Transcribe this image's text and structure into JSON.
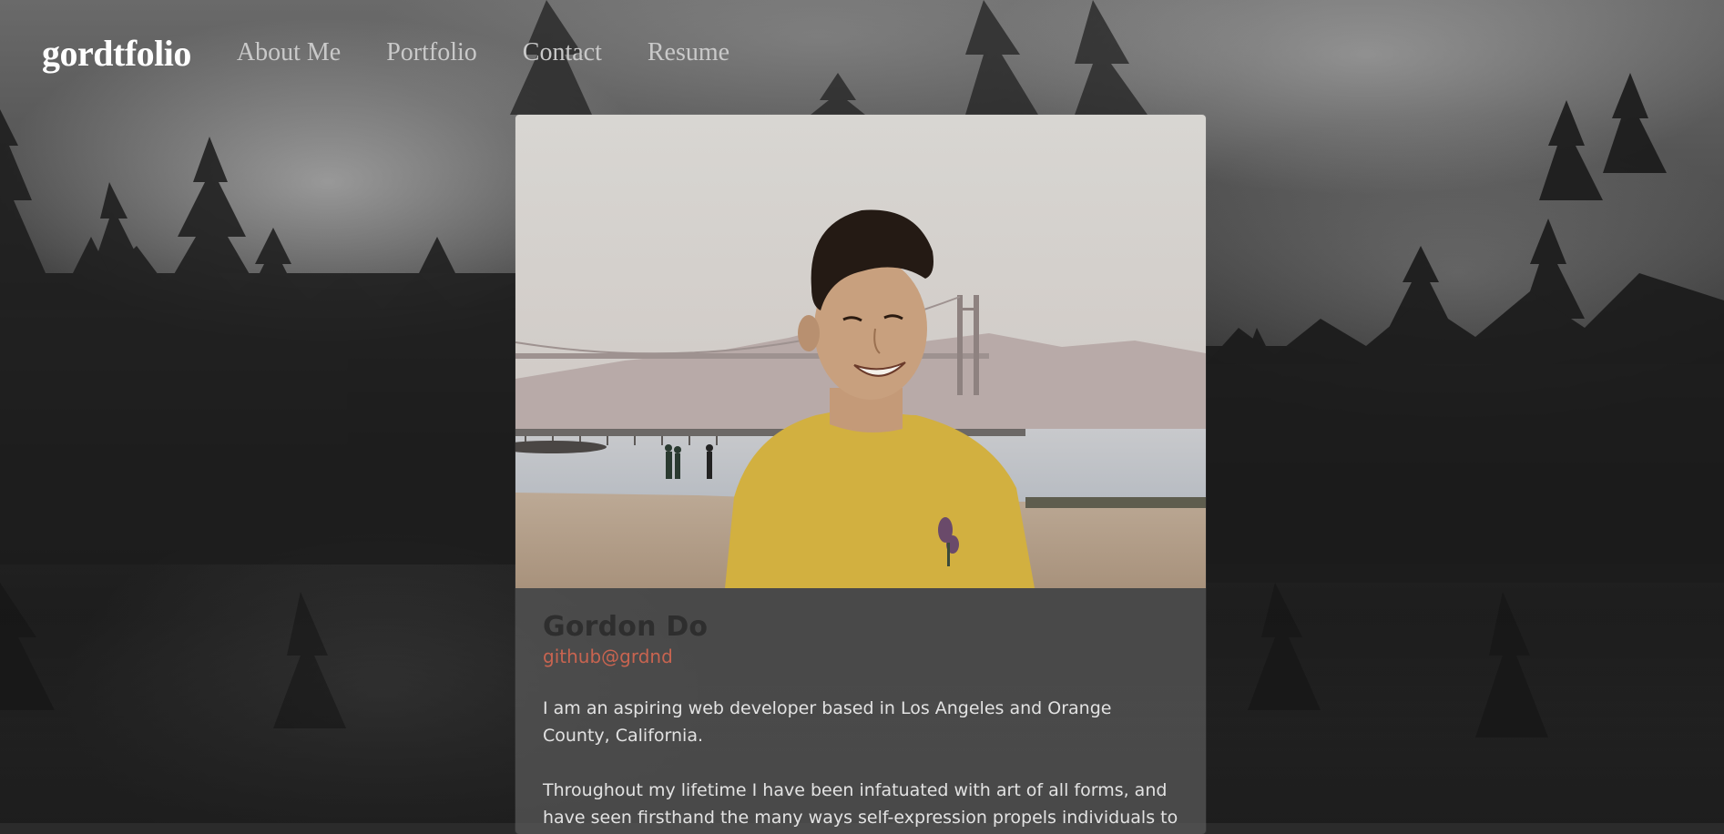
{
  "nav": {
    "logo": "gordtfolio",
    "links": [
      "About Me",
      "Portfolio",
      "Contact",
      "Resume"
    ]
  },
  "profile": {
    "name": "Gordon Do",
    "github": "github@grdnd",
    "paragraphs": [
      "I am an aspiring web developer based in Los Angeles and Orange County, California.",
      "Throughout my lifetime I have been infatuated with art of all forms, and have seen firsthand the many ways self-expression propels individuals to"
    ]
  },
  "colors": {
    "link_accent": "#c86450",
    "shirt": "#d2b040"
  }
}
